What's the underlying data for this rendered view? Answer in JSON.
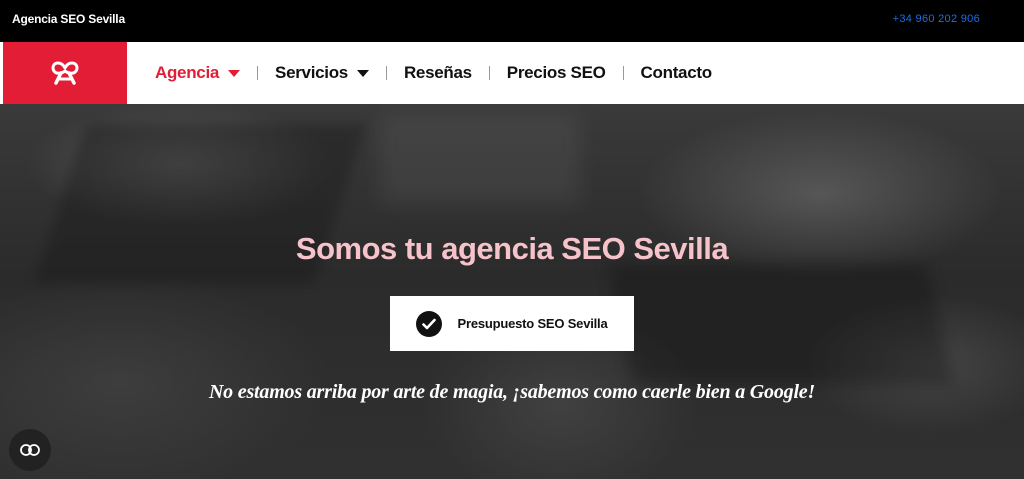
{
  "topbar": {
    "brand": "Agencia SEO Sevilla",
    "phone": "+34 960 202 906"
  },
  "header": {
    "logo_icon": "ribbon-logo-icon",
    "nav": [
      {
        "label": "Agencia",
        "has_dropdown": true,
        "active": true
      },
      {
        "label": "Servicios",
        "has_dropdown": true,
        "active": false
      },
      {
        "label": "Reseñas",
        "has_dropdown": false,
        "active": false
      },
      {
        "label": "Precios SEO",
        "has_dropdown": false,
        "active": false
      },
      {
        "label": "Contacto",
        "has_dropdown": false,
        "active": false
      }
    ]
  },
  "hero": {
    "title": "Somos tu agencia SEO Sevilla",
    "cta_label": "Presupuesto SEO Sevilla",
    "cta_icon": "check-circle-icon",
    "subtitle": "No estamos arriba por arte de magia, ¡sabemos como caerle bien a Google!"
  },
  "floating": {
    "cookie_icon": "cookie-settings-icon"
  },
  "colors": {
    "brand_red": "#e21d35",
    "title_pink": "#f7c3cb",
    "phone_blue": "#1e6fe0",
    "topbar_bg": "#000000"
  }
}
